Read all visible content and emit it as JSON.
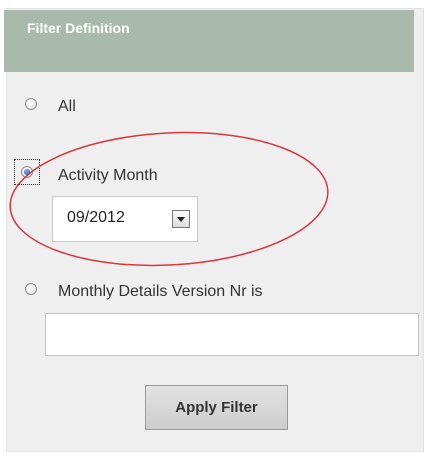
{
  "panel": {
    "title": "Filter Definition"
  },
  "options": {
    "all": {
      "label": "All",
      "checked": false
    },
    "activity_month": {
      "label": "Activity Month",
      "checked": true
    },
    "version_nr": {
      "label": "Monthly Details Version Nr is",
      "checked": false
    }
  },
  "activity_month_select": {
    "value": "09/2012"
  },
  "version_input": {
    "value": ""
  },
  "apply_button": {
    "label": "Apply Filter"
  },
  "colors": {
    "header_bg": "#a9b9ac",
    "panel_bg": "#efefef",
    "annotation_red": "#d9363e"
  }
}
